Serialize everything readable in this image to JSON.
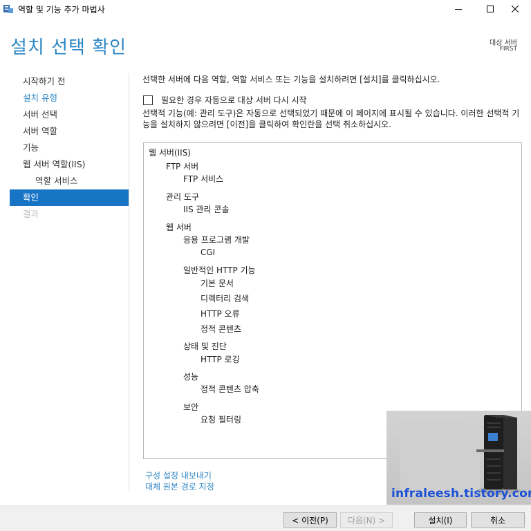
{
  "window": {
    "title": "역할 및 기능 추가 마법사"
  },
  "header": {
    "page_title": "설치 선택 확인",
    "destination_label": "대상 서버",
    "destination_server": "FIRST"
  },
  "nav": {
    "items": [
      {
        "label": "시작하기 전"
      },
      {
        "label": "설치 유형"
      },
      {
        "label": "서버 선택"
      },
      {
        "label": "서버 역할"
      },
      {
        "label": "기능"
      },
      {
        "label": "웹 서버 역할(IIS)"
      },
      {
        "label": "역할 서비스"
      },
      {
        "label": "확인"
      },
      {
        "label": "결과"
      }
    ]
  },
  "main": {
    "intro": "선택한 서버에 다음 역할, 역할 서비스 또는 기능을 설치하려면 [설치]를 클릭하십시오.",
    "restart_label": "필요한 경우 자동으로 대상 서버 다시 시작",
    "note": "선택적 기능(예: 관리 도구)은 자동으로 선택되었기 때문에 이 페이지에 표시될 수 있습니다. 이러한 선택적 기능을 설치하지 않으려면 [이전]을 클릭하여 확인란을 선택 취소하십시오.",
    "selections": [
      {
        "label": "웹 서버(IIS)"
      },
      {
        "label": "FTP 서버"
      },
      {
        "label": "FTP 서비스"
      },
      {
        "label": "관리 도구"
      },
      {
        "label": "IIS 관리 콘솔"
      },
      {
        "label": "웹 서버"
      },
      {
        "label": "응용 프로그램 개발"
      },
      {
        "label": "CGI"
      },
      {
        "label": "일반적인 HTTP 기능"
      },
      {
        "label": "기본 문서"
      },
      {
        "label": "디렉터리 검색"
      },
      {
        "label": "HTTP 오류"
      },
      {
        "label": "정적 콘텐츠"
      },
      {
        "label": "상태 및 진단"
      },
      {
        "label": "HTTP 로깅"
      },
      {
        "label": "성능"
      },
      {
        "label": "정적 콘텐츠 압축"
      },
      {
        "label": "보안"
      },
      {
        "label": "요청 필터링"
      }
    ],
    "export_link": "구성 설정 내보내기",
    "alt_source_link": "대체 원본 경로 지정"
  },
  "footer": {
    "prev": "< 이전(P)",
    "next": "다음(N) >",
    "install": "설치(I)",
    "cancel": "취소"
  },
  "watermark": {
    "text": "infraleesh.tistory.com"
  },
  "colors": {
    "accent": "#2b86c5",
    "nav_active_bg": "#1874c5",
    "watermark_text": "#1a4fd6"
  }
}
